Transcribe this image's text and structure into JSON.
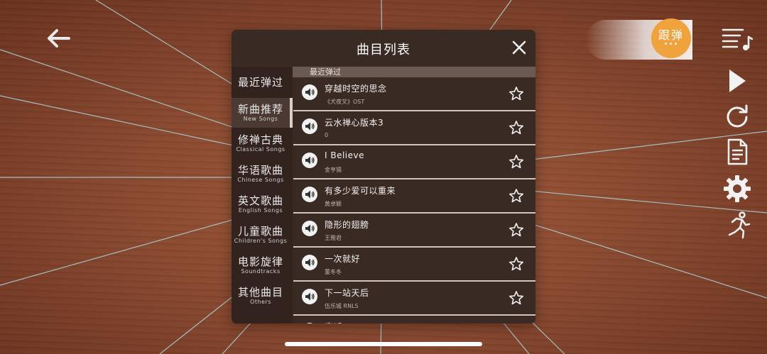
{
  "top_bar": {
    "follow_label": "跟弹",
    "follow_dots": "•••"
  },
  "modal": {
    "title": "曲目列表",
    "categories": [
      {
        "zh": "最近弹过",
        "en": ""
      },
      {
        "zh": "新曲推荐",
        "en": "New Songs"
      },
      {
        "zh": "修禅古典",
        "en": "Classical Songs"
      },
      {
        "zh": "华语歌曲",
        "en": "Chinese Songs"
      },
      {
        "zh": "英文歌曲",
        "en": "English Songs"
      },
      {
        "zh": "儿童歌曲",
        "en": "Children's Songs"
      },
      {
        "zh": "电影旋律",
        "en": "Soundtracks"
      },
      {
        "zh": "其他曲目",
        "en": "Others"
      }
    ],
    "active_category": "新曲推荐",
    "section_label": "最近弹过",
    "songs": [
      {
        "title": "穿越时空的思念",
        "artist": "《犬夜叉》OST"
      },
      {
        "title": "云水禅心版本3",
        "artist": "0"
      },
      {
        "title": "I Believe",
        "artist": "金亨锡"
      },
      {
        "title": "有多少爱可以重来",
        "artist": "黄卓颖"
      },
      {
        "title": "隐形的翅膀",
        "artist": "王雅君"
      },
      {
        "title": "一次就好",
        "artist": "董冬冬"
      },
      {
        "title": "下一站天后",
        "artist": "伍乐城 RNLS"
      },
      {
        "title": "童话",
        "artist": ""
      }
    ]
  },
  "colors": {
    "accent": "#f0a23c",
    "modal_bg": "#3a2a24",
    "string_color": "#9ad0d6"
  },
  "icons": [
    "back-arrow-icon",
    "playlist-icon",
    "play-icon",
    "replay-icon",
    "sheet-icon",
    "gear-icon",
    "runner-icon",
    "speaker-icon",
    "star-icon",
    "close-icon"
  ]
}
